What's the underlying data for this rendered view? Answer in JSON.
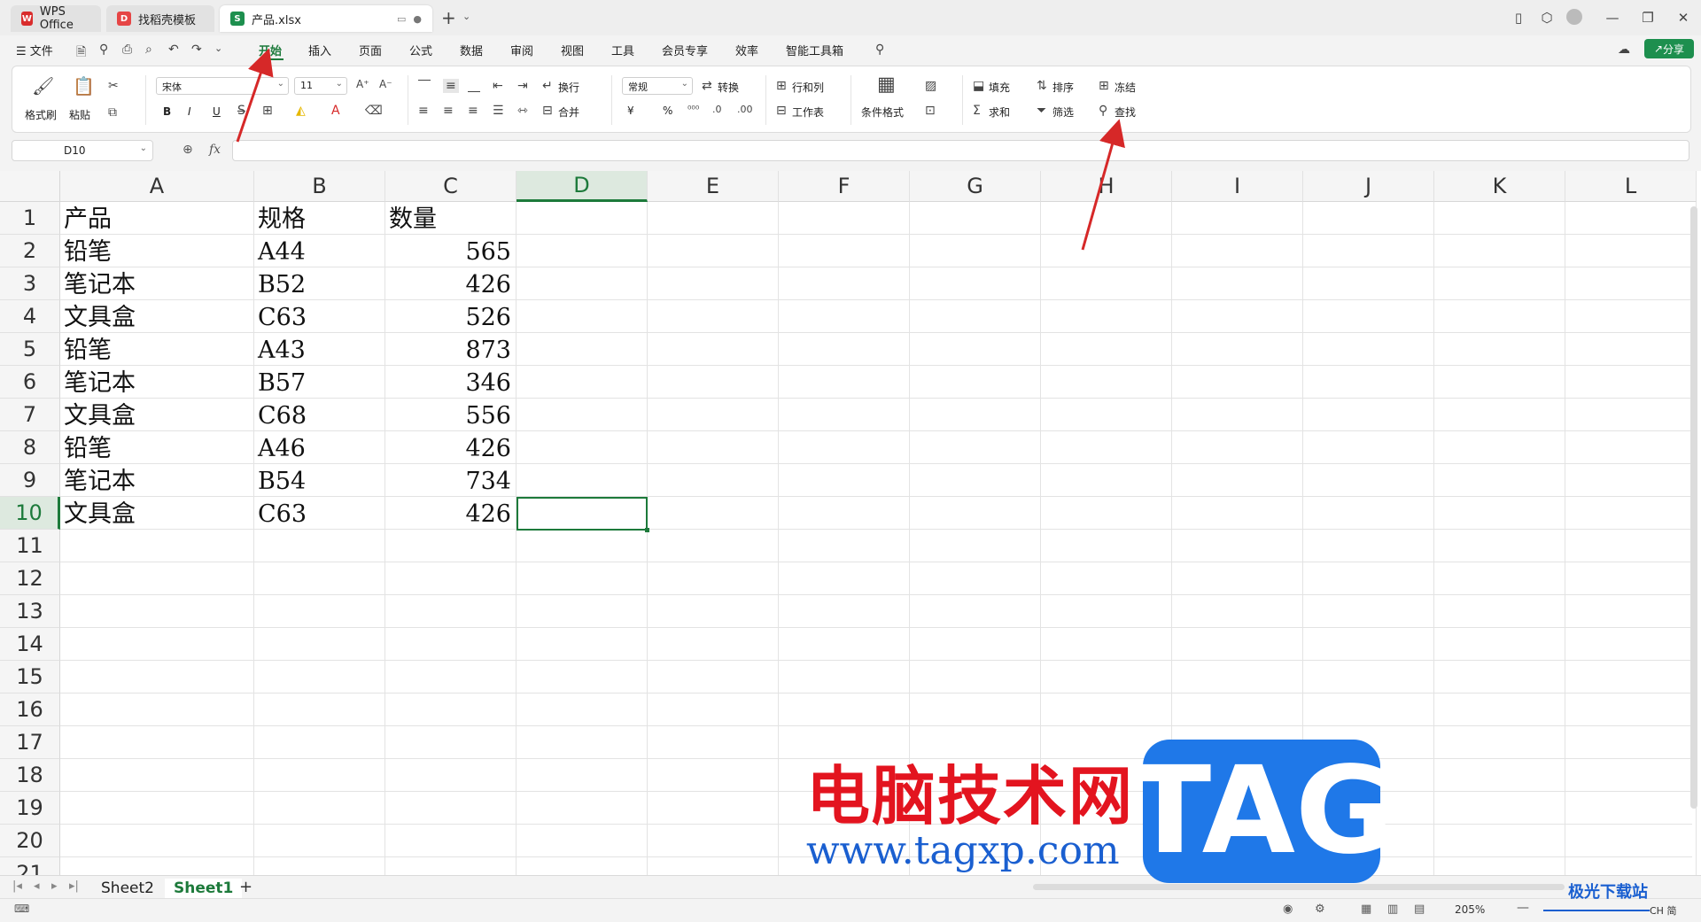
{
  "titlebar": {
    "tabs": [
      {
        "label": "WPS Office",
        "logo": "W"
      },
      {
        "label": "找稻壳模板",
        "logo": "D"
      },
      {
        "label": "产品.xlsx",
        "logo": "S"
      }
    ],
    "new_tab": "+"
  },
  "menubar": {
    "file": "文件",
    "items": [
      "开始",
      "插入",
      "页面",
      "公式",
      "数据",
      "审阅",
      "视图",
      "工具",
      "会员专享",
      "效率",
      "智能工具箱"
    ],
    "share": "分享"
  },
  "ribbon": {
    "format_painter": "格式刷",
    "paste": "粘贴",
    "font_name": "宋体",
    "font_size": "11",
    "bold": "B",
    "italic": "I",
    "underline": "U",
    "wrap": "换行",
    "merge": "合并",
    "number_format": "常规",
    "convert": "转换",
    "rows_cols": "行和列",
    "worksheet": "工作表",
    "conditional_format": "条件格式",
    "fill": "填充",
    "sort": "排序",
    "freeze": "冻结",
    "sum": "求和",
    "filter": "筛选",
    "find": "查找",
    "currency": "¥",
    "percent": "%"
  },
  "formula_bar": {
    "name_box": "D10",
    "fx": "fx"
  },
  "grid": {
    "columns": [
      "A",
      "B",
      "C",
      "D",
      "E",
      "F",
      "G",
      "H",
      "I",
      "J",
      "K",
      "L"
    ],
    "rows": [
      "1",
      "2",
      "3",
      "4",
      "5",
      "6",
      "7",
      "8",
      "9",
      "10",
      "11",
      "12",
      "13",
      "14",
      "15",
      "16",
      "17",
      "18",
      "19",
      "20",
      "21"
    ],
    "data": [
      [
        "产品",
        "规格",
        "数量"
      ],
      [
        "铅笔",
        "A44",
        "565"
      ],
      [
        "笔记本",
        "B52",
        "426"
      ],
      [
        "文具盒",
        "C63",
        "526"
      ],
      [
        "铅笔",
        "A43",
        "873"
      ],
      [
        "笔记本",
        "B57",
        "346"
      ],
      [
        "文具盒",
        "C68",
        "556"
      ],
      [
        "铅笔",
        "A46",
        "426"
      ],
      [
        "笔记本",
        "B54",
        "734"
      ],
      [
        "文具盒",
        "C63",
        "426"
      ]
    ]
  },
  "sheets": [
    "Sheet2",
    "Sheet1"
  ],
  "status": {
    "zoom": "205%",
    "ime": "CH 简"
  },
  "watermark": {
    "text": "电脑技术网",
    "url": "www.tagxp.com",
    "tag": "TAG",
    "site": "极光下载站"
  },
  "colors": {
    "accent": "#1d7a3b",
    "arrow": "#d62828"
  }
}
